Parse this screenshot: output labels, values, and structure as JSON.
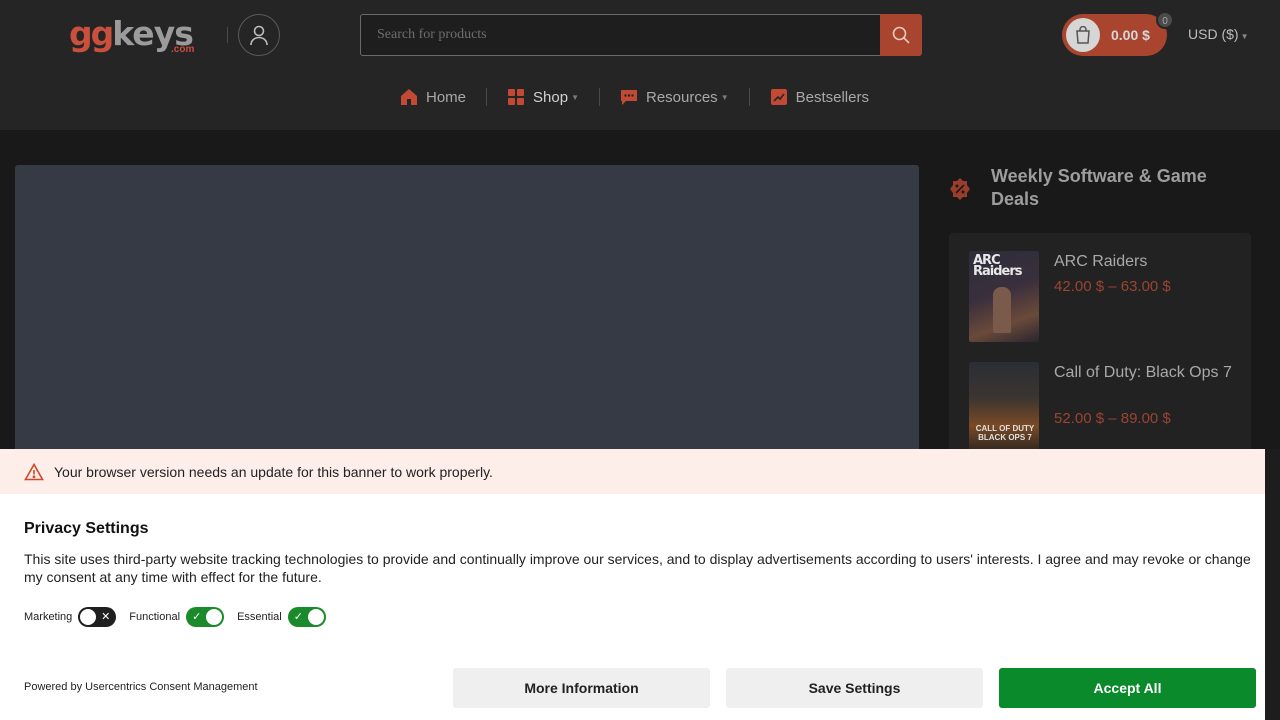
{
  "header": {
    "logo": {
      "part1": "gg",
      "part2": "keys",
      "suffix": ".com"
    },
    "search": {
      "placeholder": "Search for products"
    },
    "cart": {
      "total": "0.00 $",
      "count": "0"
    },
    "currency": "USD ($)"
  },
  "nav": {
    "items": [
      {
        "label": "Home",
        "icon": "home-icon",
        "has_menu": false
      },
      {
        "label": "Shop",
        "icon": "grid-icon",
        "has_menu": true
      },
      {
        "label": "Resources",
        "icon": "chat-icon",
        "has_menu": true
      },
      {
        "label": "Bestsellers",
        "icon": "trend-icon",
        "has_menu": false
      }
    ]
  },
  "deals": {
    "title": "Weekly Software & Game Deals",
    "items": [
      {
        "name": "ARC Raiders",
        "price": "42.00 $ – 63.00 $",
        "cover_text": "ARC Raiders"
      },
      {
        "name": "Call of Duty: Black Ops 7",
        "price": "52.00 $ – 89.00 $",
        "cover_text": "CALL OF DUTY BLACK OPS 7"
      }
    ]
  },
  "consent": {
    "warning": "Your browser version needs an update for this banner to work properly.",
    "title": "Privacy Settings",
    "text": "This site uses third-party website tracking technologies to provide and continually improve our services, and to display advertisements according to users' interests. I agree and may revoke or change my consent at any time with effect for the future.",
    "toggles": [
      {
        "label": "Marketing",
        "on": false
      },
      {
        "label": "Functional",
        "on": true
      },
      {
        "label": "Essential",
        "on": true
      }
    ],
    "powered_by": "Powered by Usercentrics Consent Management",
    "buttons": {
      "more": "More Information",
      "save": "Save Settings",
      "accept": "Accept All"
    }
  },
  "colors": {
    "accent": "#a9452f",
    "accept_green": "#0b8a2c",
    "toggle_on": "#1a8a2a"
  }
}
